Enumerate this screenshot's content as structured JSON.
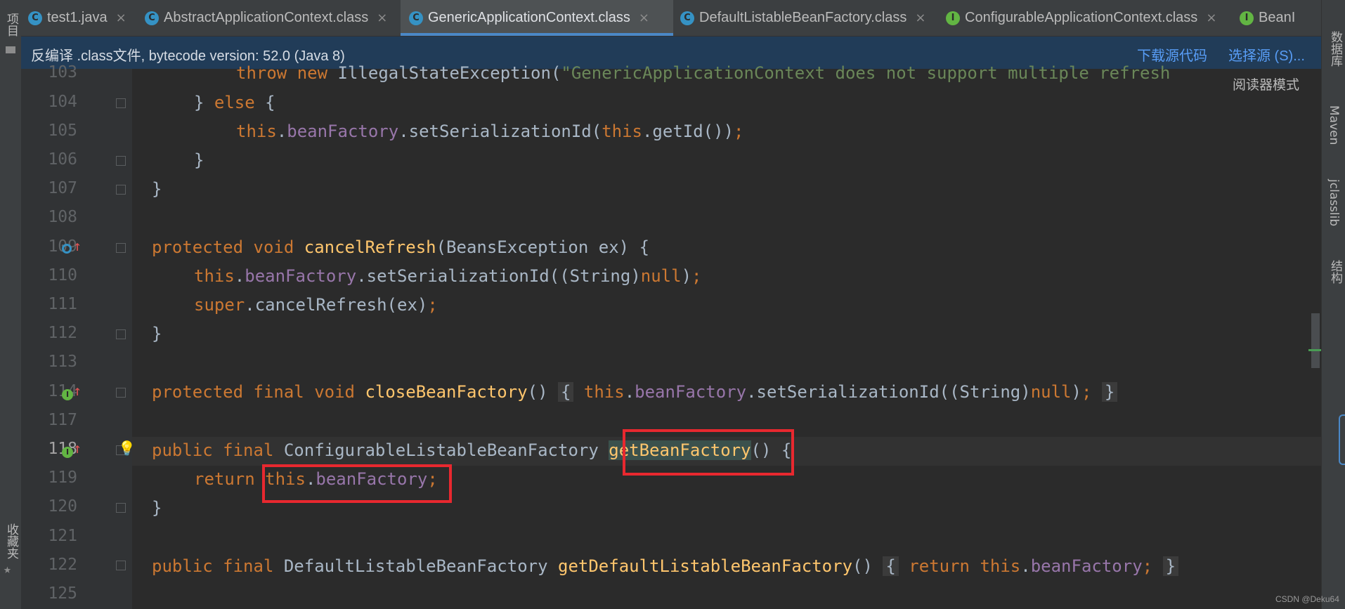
{
  "tabs": [
    {
      "label": "test1.java",
      "icon": "C",
      "icon_color": "#3592c4",
      "active": false
    },
    {
      "label": "AbstractApplicationContext.class",
      "icon": "C",
      "icon_color": "#3592c4",
      "active": false
    },
    {
      "label": "GenericApplicationContext.class",
      "icon": "C",
      "icon_color": "#3592c4",
      "active": true
    },
    {
      "label": "DefaultListableBeanFactory.class",
      "icon": "C",
      "icon_color": "#3592c4",
      "active": false
    },
    {
      "label": "ConfigurableApplicationContext.class",
      "icon": "I",
      "icon_color": "#62b543",
      "active": false
    },
    {
      "label": "BeanI",
      "icon": "I",
      "icon_color": "#62b543",
      "active": false
    }
  ],
  "tab_close_glyph": "×",
  "tab_more_glyph": "⌄",
  "banner": {
    "text": "反编译 .class文件, bytecode version: 52.0 (Java 8)",
    "download_source": "下载源代码",
    "choose_source": "选择源 (S)..."
  },
  "left_tools": {
    "project": "项目",
    "favorites": "收藏夹"
  },
  "right_tools": {
    "database": "数据库",
    "maven": "Maven",
    "jclasslib": "jclasslib",
    "structure": "结构"
  },
  "reader_mode": "阅读器模式",
  "line_numbers": [
    "103",
    "104",
    "105",
    "106",
    "107",
    "108",
    "109",
    "110",
    "111",
    "112",
    "113",
    "114",
    "117",
    "118",
    "119",
    "120",
    "121",
    "122",
    "125"
  ],
  "code": {
    "l103": {
      "kw1": "throw",
      "kw2": "new",
      "cls": "IllegalStateException(",
      "str": "\"GenericApplicationContext does not support multiple refresh"
    },
    "l104": {
      "brace": "} ",
      "kw": "else",
      "rest": " {"
    },
    "l105": {
      "kw1": "this",
      "dot": ".",
      "fld": "beanFactory",
      "mid": ".setSerializationId(",
      "kw2": "this",
      "rest": ".getId())",
      "semi": ";"
    },
    "l106": {
      "text": "}"
    },
    "l107": {
      "text": "}"
    },
    "l109": {
      "kw1": "protected",
      "kw2": "void",
      "fn": "cancelRefresh",
      "rest": "(BeansException ex) {"
    },
    "l110": {
      "kw1": "this",
      "dot": ".",
      "fld": "beanFactory",
      "mid": ".setSerializationId((String)",
      "kw2": "null",
      "rest": ")",
      "semi": ";"
    },
    "l111": {
      "kw": "super",
      "rest": ".cancelRefresh(ex)",
      "semi": ";"
    },
    "l112": {
      "text": "}"
    },
    "l114": {
      "kw1": "protected",
      "kw2": "final",
      "kw3": "void",
      "fn": "closeBeanFactory",
      "paren": "()",
      "fold_open": "{",
      "kw4": "this",
      "dot": ".",
      "fld": "beanFactory",
      "mid": ".setSerializationId((String)",
      "kw5": "null",
      "rest": ")",
      "semi": ";",
      "fold_close": "}"
    },
    "l118": {
      "kw1": "public",
      "kw2": "final",
      "type": "ConfigurableListableBeanFactory",
      "fn": "getBeanFactory",
      "rest": "() {"
    },
    "l119": {
      "kw1": "return",
      "kw2": "this",
      "dot": ".",
      "fld": "beanFactory",
      "semi": ";"
    },
    "l120": {
      "text": "}"
    },
    "l122": {
      "kw1": "public",
      "kw2": "final",
      "type": "DefaultListableBeanFactory",
      "fn": "getDefaultListableBeanFactory",
      "paren": "()",
      "fold_open": "{",
      "kw3": "return",
      "kw4": "this",
      "dot": ".",
      "fld": "beanFactory",
      "semi": ";",
      "fold_close": "}"
    }
  },
  "gutter_marks": {
    "override_up": "↑",
    "intention_bulb": "💡",
    "implements_icon": "I",
    "overrides_icon": "O"
  },
  "watermark": "CSDN @Deku64"
}
